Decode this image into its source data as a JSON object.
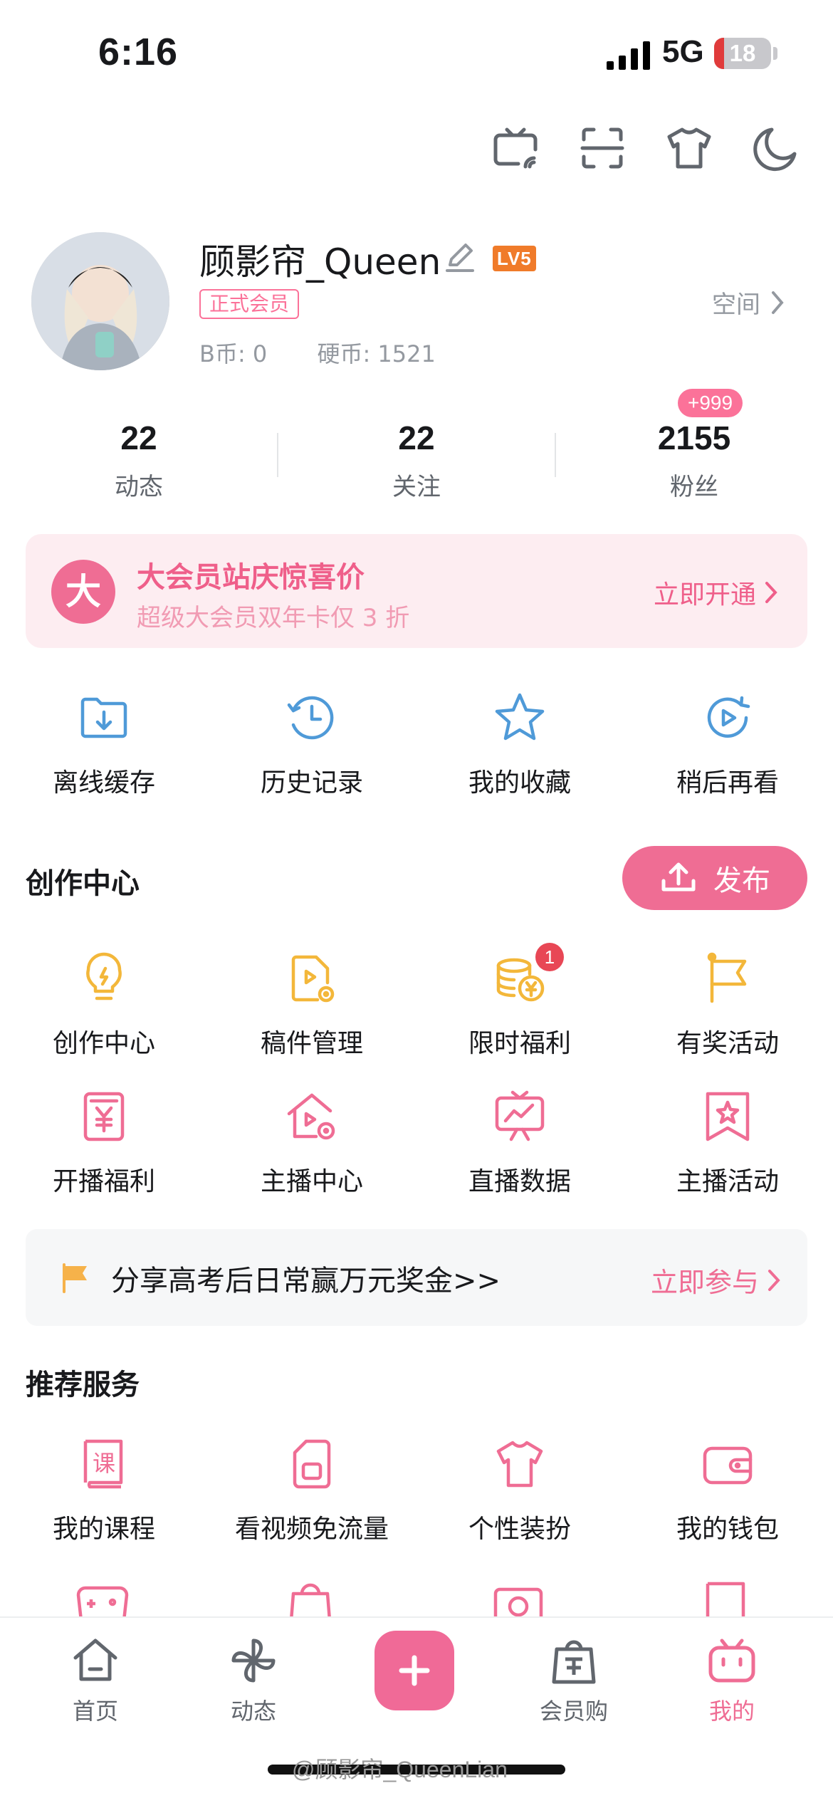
{
  "status": {
    "time": "6:16",
    "network": "5G",
    "battery": "18",
    "battery_level_percent": 18
  },
  "profile": {
    "name": "顾影帘_Queen",
    "level": "LV5",
    "vip_tag": "正式会员",
    "b_coins": "B币: 0",
    "hard_coins": "硬币: 1521",
    "space": "空间"
  },
  "stats": [
    {
      "value": "22",
      "label": "动态"
    },
    {
      "value": "22",
      "label": "关注"
    },
    {
      "value": "2155",
      "label": "粉丝",
      "badge": "+999"
    }
  ],
  "vip_banner": {
    "logo": "大",
    "title": "大会员站庆惊喜价",
    "subtitle": "超级大会员双年卡仅 3 折",
    "cta": "立即开通"
  },
  "quick": [
    {
      "label": "离线缓存",
      "icon": "offline-cache-icon"
    },
    {
      "label": "历史记录",
      "icon": "history-icon"
    },
    {
      "label": "我的收藏",
      "icon": "star-icon"
    },
    {
      "label": "稍后再看",
      "icon": "watch-later-icon"
    }
  ],
  "creator": {
    "title": "创作中心",
    "publish": "发布",
    "items": [
      {
        "label": "创作中心",
        "icon": "lightbulb-icon"
      },
      {
        "label": "稿件管理",
        "icon": "manuscript-icon"
      },
      {
        "label": "限时福利",
        "icon": "coins-icon",
        "badge": "1"
      },
      {
        "label": "有奖活动",
        "icon": "flag-icon"
      },
      {
        "label": "开播福利",
        "icon": "yen-card-icon"
      },
      {
        "label": "主播中心",
        "icon": "house-icon"
      },
      {
        "label": "直播数据",
        "icon": "tv-chart-icon"
      },
      {
        "label": "主播活动",
        "icon": "bookmark-star-icon"
      }
    ]
  },
  "promo": {
    "text": "分享高考后日常赢万元奖金>>",
    "cta": "立即参与"
  },
  "services": {
    "title": "推荐服务",
    "items": [
      {
        "label": "我的课程",
        "icon": "course-icon",
        "glyph": "课"
      },
      {
        "label": "看视频免流量",
        "icon": "sim-card-icon"
      },
      {
        "label": "个性装扮",
        "icon": "tshirt-icon"
      },
      {
        "label": "我的钱包",
        "icon": "wallet-icon"
      }
    ]
  },
  "tabs": [
    {
      "label": "首页",
      "icon": "home-icon"
    },
    {
      "label": "动态",
      "icon": "pinwheel-icon"
    },
    {
      "label": "",
      "icon": "plus-icon"
    },
    {
      "label": "会员购",
      "icon": "shopping-bag-icon"
    },
    {
      "label": "我的",
      "icon": "tv-mascot-icon"
    }
  ],
  "watermark": "@顾影帘_QueenLian",
  "colors": {
    "accent": "#fb7299",
    "text": "#18191c",
    "muted": "#9499a0"
  }
}
